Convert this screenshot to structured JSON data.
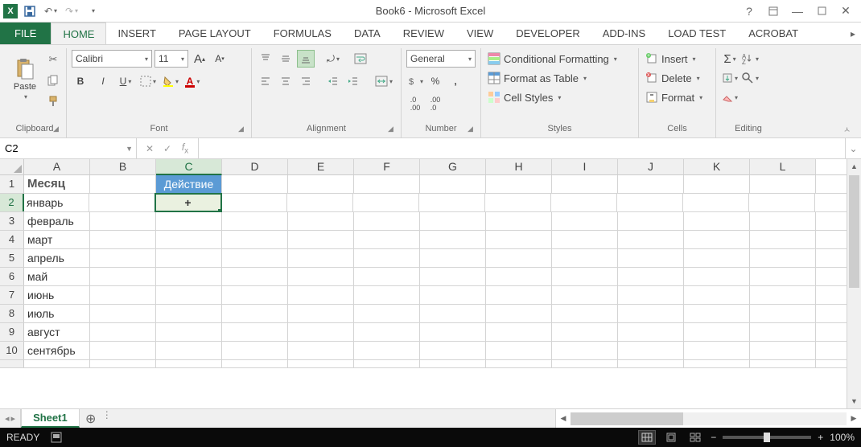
{
  "title": "Book6 - Microsoft Excel",
  "tabs": [
    "FILE",
    "HOME",
    "INSERT",
    "PAGE LAYOUT",
    "FORMULAS",
    "DATA",
    "REVIEW",
    "VIEW",
    "DEVELOPER",
    "ADD-INS",
    "LOAD TEST",
    "ACROBAT"
  ],
  "activeTab": "HOME",
  "clipboard": {
    "paste": "Paste",
    "label": "Clipboard"
  },
  "font": {
    "name": "Calibri",
    "size": "11",
    "label": "Font"
  },
  "alignment": {
    "label": "Alignment"
  },
  "number": {
    "format": "General",
    "label": "Number"
  },
  "styles": {
    "cond": "Conditional Formatting",
    "table": "Format as Table",
    "cell": "Cell Styles",
    "label": "Styles"
  },
  "cells": {
    "insert": "Insert",
    "delete": "Delete",
    "format": "Format",
    "label": "Cells"
  },
  "editing": {
    "label": "Editing"
  },
  "namebox": "C2",
  "formula": "",
  "columns": [
    "A",
    "B",
    "C",
    "D",
    "E",
    "F",
    "G",
    "H",
    "I",
    "J",
    "K",
    "L"
  ],
  "activeCol": "C",
  "activeRow": 2,
  "rows": [
    {
      "n": 1,
      "cells": {
        "A": "Месяц",
        "C": "Действие"
      }
    },
    {
      "n": 2,
      "cells": {
        "A": "январь",
        "C": "+"
      }
    },
    {
      "n": 3,
      "cells": {
        "A": "февраль"
      }
    },
    {
      "n": 4,
      "cells": {
        "A": "март"
      }
    },
    {
      "n": 5,
      "cells": {
        "A": "апрель"
      }
    },
    {
      "n": 6,
      "cells": {
        "A": "май"
      }
    },
    {
      "n": 7,
      "cells": {
        "A": "июнь"
      }
    },
    {
      "n": 8,
      "cells": {
        "A": "июль"
      }
    },
    {
      "n": 9,
      "cells": {
        "A": "август"
      }
    },
    {
      "n": 10,
      "cells": {
        "A": "сентябрь"
      }
    }
  ],
  "sheet": "Sheet1",
  "status": {
    "ready": "READY",
    "zoom": "100%"
  }
}
